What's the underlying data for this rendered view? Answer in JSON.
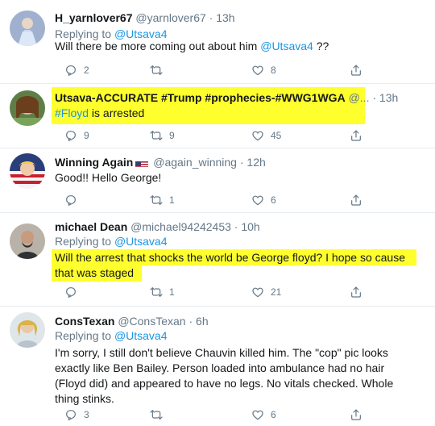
{
  "tweets": [
    {
      "display_name": "H_yarnlover67",
      "handle": "@yarnlover67",
      "time": "13h",
      "replying_label": "Replying to",
      "replying_to": "@Utsava4",
      "text_pre": "Will there be more coming out about him ",
      "text_mention": "@Utsava4",
      "text_post": " ??",
      "counts": {
        "reply": "2",
        "retweet": "",
        "like": "8"
      }
    },
    {
      "display_name": "Utsava-ACCURATE #Trump #prophecies-#WWG1WGA",
      "handle": "@...",
      "time": "13h",
      "text_hashtag": "#Floyd",
      "text_post": " is arrested",
      "counts": {
        "reply": "9",
        "retweet": "9",
        "like": "45"
      }
    },
    {
      "display_name": "Winning Again",
      "handle": "@again_winning",
      "time": "12h",
      "text": "Good!!  Hello George!",
      "counts": {
        "reply": "",
        "retweet": "1",
        "like": "6"
      }
    },
    {
      "display_name": "michael Dean",
      "handle": "@michael94242453",
      "time": "10h",
      "replying_label": "Replying to",
      "replying_to": "@Utsava4",
      "text_line1": "Will the arrest that shocks the world be George floyd? I hope so cause",
      "text_line2": "that was staged",
      "counts": {
        "reply": "",
        "retweet": "1",
        "like": "21"
      }
    },
    {
      "display_name": "ConsTexan",
      "handle": "@ConsTexan",
      "time": "6h",
      "replying_label": "Replying to",
      "replying_to": "@Utsava4",
      "text": "I'm sorry, I still don't believe Chauvin killed him. The \"cop\"  pic looks exactly like Ben Bailey.  Person loaded into ambulance had no hair (Floyd did) and appeared to have no legs. No vitals checked. Whole thing stinks.",
      "counts": {
        "reply": "3",
        "retweet": "",
        "like": "6"
      }
    }
  ],
  "separator": "·",
  "more_glyph": "···",
  "colors": {
    "highlight": "#ffff2e",
    "link": "#1b95e0",
    "muted": "#657786"
  },
  "icons": [
    "reply-icon",
    "retweet-icon",
    "like-icon",
    "share-icon",
    "caret-icon",
    "us-flag-icon"
  ]
}
